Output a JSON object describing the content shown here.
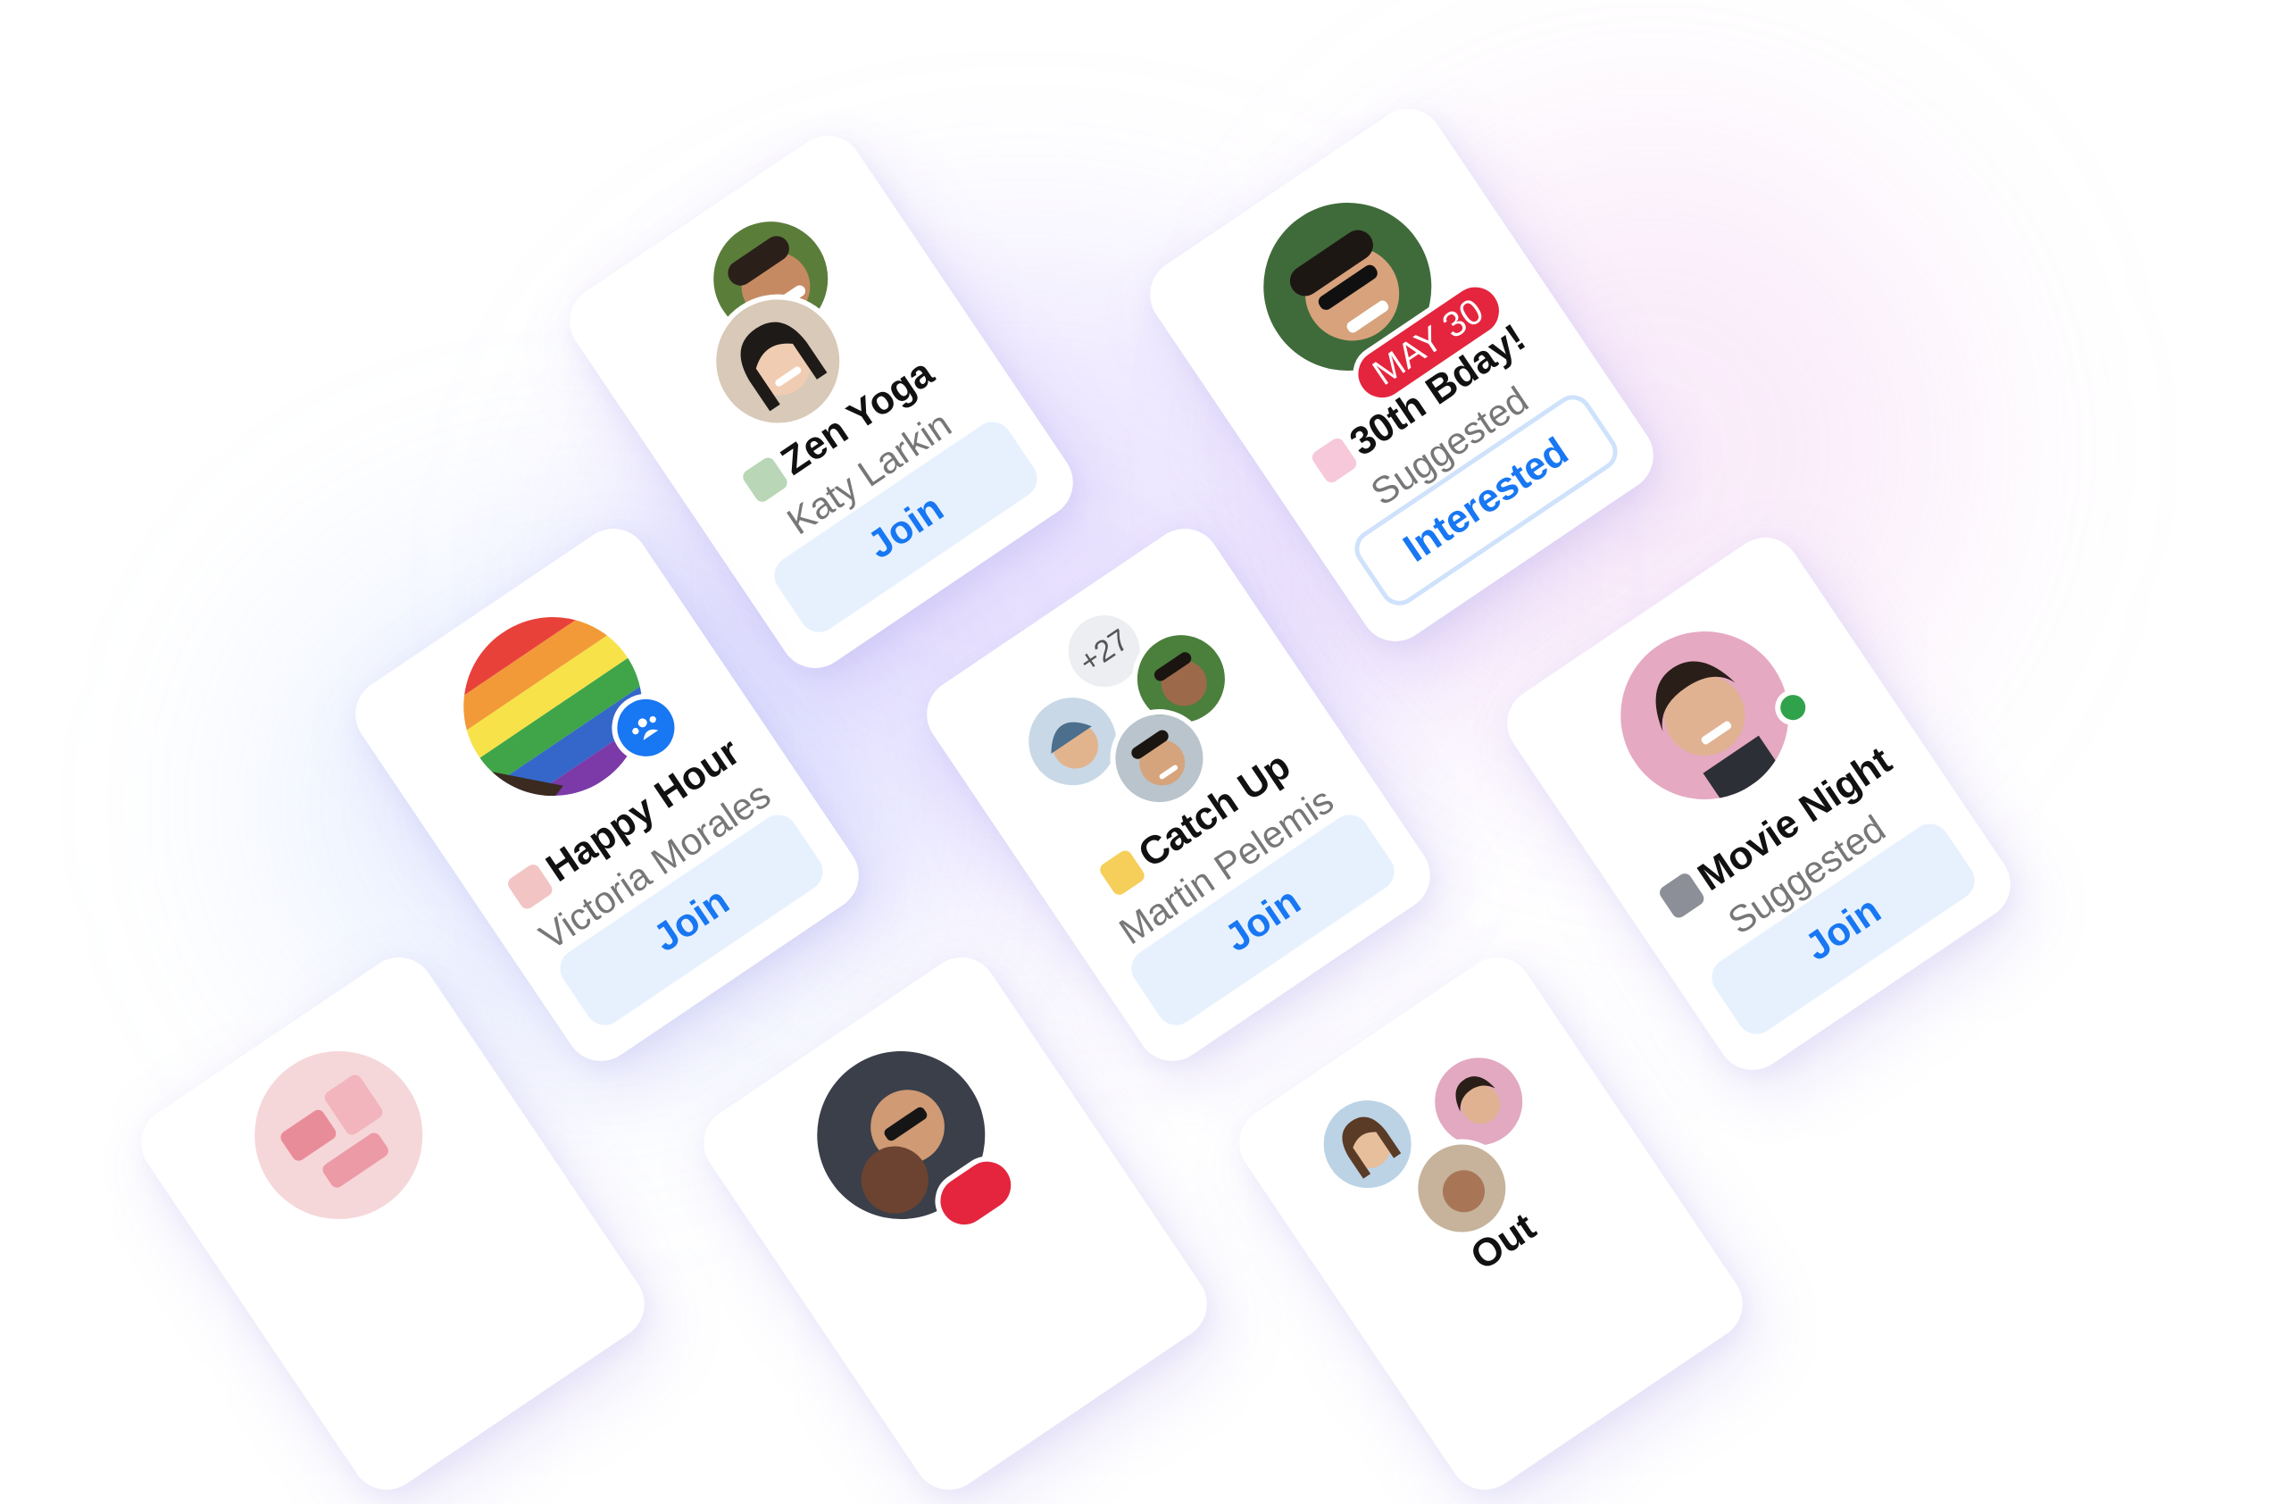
{
  "cards": [
    {
      "id": "zen-yoga",
      "title": "Zen Yoga",
      "subtitle": "Katy Larkin",
      "action": "Join"
    },
    {
      "id": "bday",
      "title": "30th Bday!",
      "subtitle": "Suggested",
      "action": "Interested",
      "badge": "MAY 30"
    },
    {
      "id": "happy-hour",
      "title": "Happy Hour",
      "subtitle": "Victoria Morales",
      "action": "Join"
    },
    {
      "id": "catch-up",
      "title": "Catch Up",
      "subtitle": "Martin Pelemis",
      "action": "Join",
      "more": "+27"
    },
    {
      "id": "movie-night",
      "title": "Movie Night",
      "subtitle": "Suggested",
      "action": "Join"
    },
    {
      "id": "partial-1",
      "title": "Out"
    }
  ],
  "colors": {
    "accent": "#1877f2",
    "button_bg": "#e7f1fe",
    "badge_red": "#e4253d",
    "online": "#31a24c"
  }
}
